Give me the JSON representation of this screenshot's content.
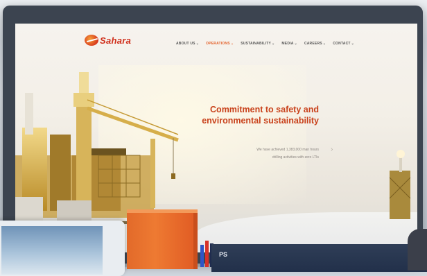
{
  "brand": {
    "logo_text": "Sahara",
    "accent_color": "#d0301c"
  },
  "nav": {
    "items": [
      {
        "label": "ABOUT US",
        "active": false
      },
      {
        "label": "OPERATIONS",
        "active": true
      },
      {
        "label": "SUSTAINABILITY",
        "active": false
      },
      {
        "label": "MEDIA",
        "active": false
      },
      {
        "label": "CAREERS",
        "active": false
      },
      {
        "label": "CONTACT",
        "active": false
      }
    ],
    "chevron": "⌄"
  },
  "hero": {
    "title_line1": "Commitment to safety and",
    "title_line2": "environmental sustainability",
    "subtitle_line1": "We have achieved 1,383,000 man hours",
    "subtitle_line2": "drilling activities with zero LTIs",
    "title_color": "#c9421c",
    "next_arrow": "›"
  },
  "foreground": {
    "book_text": "PS"
  }
}
